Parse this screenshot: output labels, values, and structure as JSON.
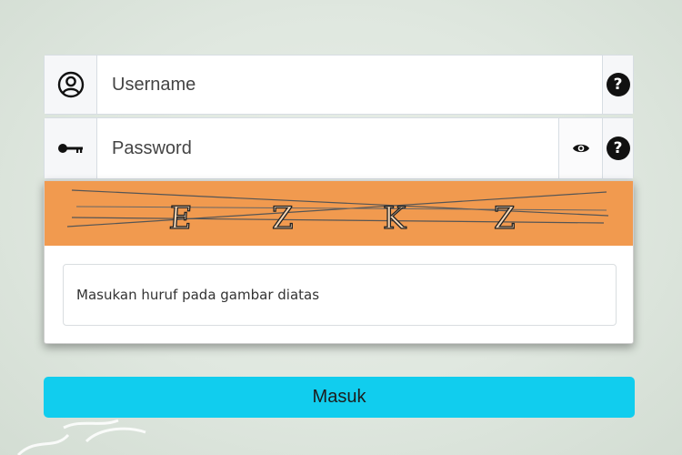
{
  "login_form": {
    "username": {
      "placeholder": "Username",
      "value": "",
      "icon": "user-circle-icon",
      "help_icon": "question-circle-icon"
    },
    "password": {
      "placeholder": "Password",
      "value": "",
      "icon": "key-icon",
      "toggle_icon": "eye-icon",
      "help_icon": "question-circle-icon"
    },
    "captcha": {
      "letters": [
        "E",
        "Z",
        "K",
        "Z"
      ],
      "input_placeholder": "Masukan huruf pada gambar diatas",
      "input_value": "",
      "background_color": "#f19a4f"
    },
    "submit_label": "Masuk",
    "submit_color": "#11cdee"
  }
}
